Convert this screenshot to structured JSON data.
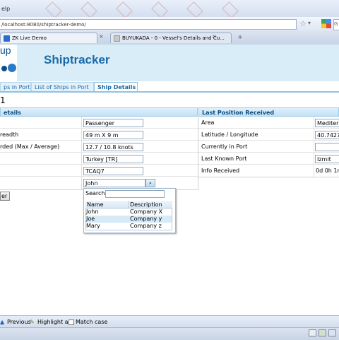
{
  "browser": {
    "menu_partial": "elp",
    "url": "/localhost:8080/shiptracker-demo/",
    "tabs": [
      {
        "label": "ZK Live Demo"
      },
      {
        "label": "BUYUKADA - 0 - Vessel's Details and Cu..."
      }
    ],
    "search_partial": "G"
  },
  "app": {
    "logo_text": "up",
    "title": "Shiptracker",
    "tabs": [
      {
        "label": "ps in Port"
      },
      {
        "label": "List of Ships in Port"
      },
      {
        "label": "Ship Details"
      }
    ],
    "active_tab": "Ship Details",
    "page_heading": "1"
  },
  "left_panel": {
    "title": "etails",
    "rows": [
      {
        "label": "",
        "value": "Passenger"
      },
      {
        "label": "readth",
        "value": "49 m X 9 m"
      },
      {
        "label": "rded (Max / Average)",
        "value": "12.7 / 10.8 knots"
      },
      {
        "label": "",
        "value": "Turkey [TR]"
      },
      {
        "label": "",
        "value": "TCAQ7"
      },
      {
        "label": "",
        "value": "John"
      }
    ],
    "button_label": "er"
  },
  "right_panel": {
    "title": "Last Position Received",
    "rows": [
      {
        "label": "Area",
        "value": "Mediterr"
      },
      {
        "label": "Latitude / Longitude",
        "value": "40.7427"
      },
      {
        "label": "Currently in Port",
        "value": ""
      },
      {
        "label": "Last Known Port",
        "value": "Izmit"
      },
      {
        "label": "Info Received",
        "value": "0d 0h 1m"
      }
    ]
  },
  "combobox_popup": {
    "search_label": "Search",
    "search_value": "",
    "columns": [
      "Name",
      "Description"
    ],
    "rows": [
      {
        "name": "John",
        "description": "Company X"
      },
      {
        "name": "Joe",
        "description": "Company y"
      },
      {
        "name": "Mary",
        "description": "Company z"
      }
    ]
  },
  "findbar": {
    "previous_label": "Previous",
    "highlight_label": "Highlight all",
    "match_case_label": "Match case"
  },
  "colors": {
    "header_bg": "#d9edf8",
    "title": "#1a6aa8",
    "link": "#1a6aa8"
  }
}
